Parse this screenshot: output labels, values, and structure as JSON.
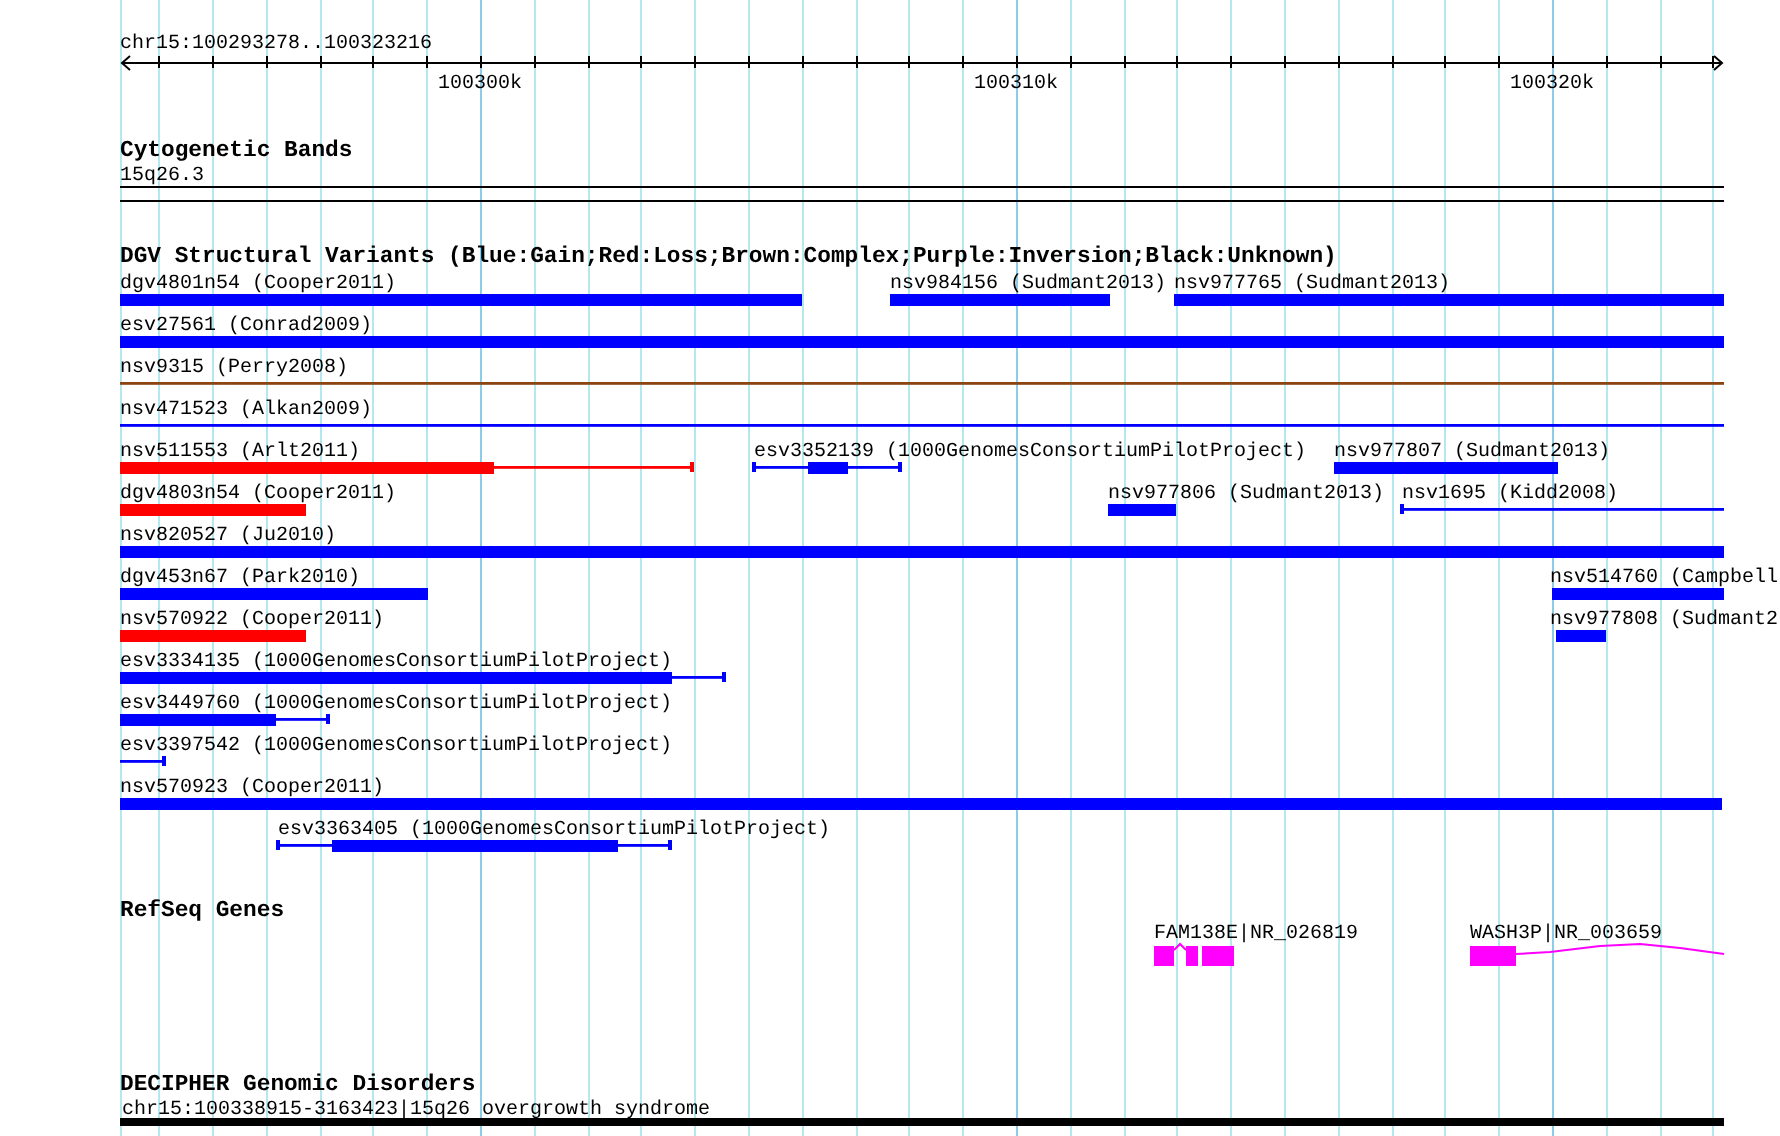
{
  "ruler": {
    "title": "chr15:100293278..100323216",
    "ticks": [
      "100300k",
      "100310k",
      "100320k"
    ]
  },
  "tracks": [
    {
      "title": "Cytogenetic Bands",
      "features": [
        {
          "label": "15q26.3",
          "kind": "band"
        }
      ]
    },
    {
      "title": "DGV Structural Variants (Blue:Gain;Red:Loss;Brown:Complex;Purple:Inversion;Black:Unknown)",
      "features": [
        {
          "label": "dgv4801n54 (Cooper2011)",
          "kind": "variant",
          "color": "#0000ff"
        },
        {
          "label": "nsv984156 (Sudmant2013)",
          "kind": "variant",
          "color": "#0000ff"
        },
        {
          "label": "nsv977765 (Sudmant2013)",
          "kind": "variant",
          "color": "#0000ff"
        },
        {
          "label": "esv27561 (Conrad2009)",
          "kind": "variant",
          "color": "#0000ff"
        },
        {
          "label": "nsv9315 (Perry2008)",
          "kind": "variant",
          "color": "#8b4513"
        },
        {
          "label": "nsv471523 (Alkan2009)",
          "kind": "variant",
          "color": "#0000ff"
        },
        {
          "label": "nsv511553 (Arlt2011)",
          "kind": "variant",
          "color": "#ff0000"
        },
        {
          "label": "esv3352139 (1000GenomesConsortiumPilotProject)",
          "kind": "variant",
          "color": "#0000ff"
        },
        {
          "label": "nsv977807 (Sudmant2013)",
          "kind": "variant",
          "color": "#0000ff"
        },
        {
          "label": "dgv4803n54 (Cooper2011)",
          "kind": "variant",
          "color": "#ff0000"
        },
        {
          "label": "nsv977806 (Sudmant2013)",
          "kind": "variant",
          "color": "#0000ff"
        },
        {
          "label": "nsv1695 (Kidd2008)",
          "kind": "variant",
          "color": "#0000ff"
        },
        {
          "label": "nsv820527 (Ju2010)",
          "kind": "variant",
          "color": "#0000ff"
        },
        {
          "label": "dgv453n67 (Park2010)",
          "kind": "variant",
          "color": "#0000ff"
        },
        {
          "label": "nsv514760 (Campbell",
          "kind": "variant",
          "color": "#0000ff"
        },
        {
          "label": "nsv570922 (Cooper2011)",
          "kind": "variant",
          "color": "#ff0000"
        },
        {
          "label": "nsv977808 (Sudmant2",
          "kind": "variant",
          "color": "#0000ff"
        },
        {
          "label": "esv3334135 (1000GenomesConsortiumPilotProject)",
          "kind": "variant",
          "color": "#0000ff"
        },
        {
          "label": "esv3449760 (1000GenomesConsortiumPilotProject)",
          "kind": "variant",
          "color": "#0000ff"
        },
        {
          "label": "esv3397542 (1000GenomesConsortiumPilotProject)",
          "kind": "variant",
          "color": "#0000ff"
        },
        {
          "label": "nsv570923 (Cooper2011)",
          "kind": "variant",
          "color": "#0000ff"
        },
        {
          "label": "esv3363405 (1000GenomesConsortiumPilotProject)",
          "kind": "variant",
          "color": "#0000ff"
        }
      ]
    },
    {
      "title": "RefSeq Genes",
      "features": [
        {
          "label": "FAM138E|NR_026819",
          "kind": "gene"
        },
        {
          "label": "WASH3P|NR_003659",
          "kind": "gene"
        }
      ]
    },
    {
      "title": "DECIPHER Genomic Disorders",
      "features": [
        {
          "label": "chr15:100338915-3163423|15q26 overgrowth syndrome",
          "kind": "region"
        }
      ]
    }
  ]
}
